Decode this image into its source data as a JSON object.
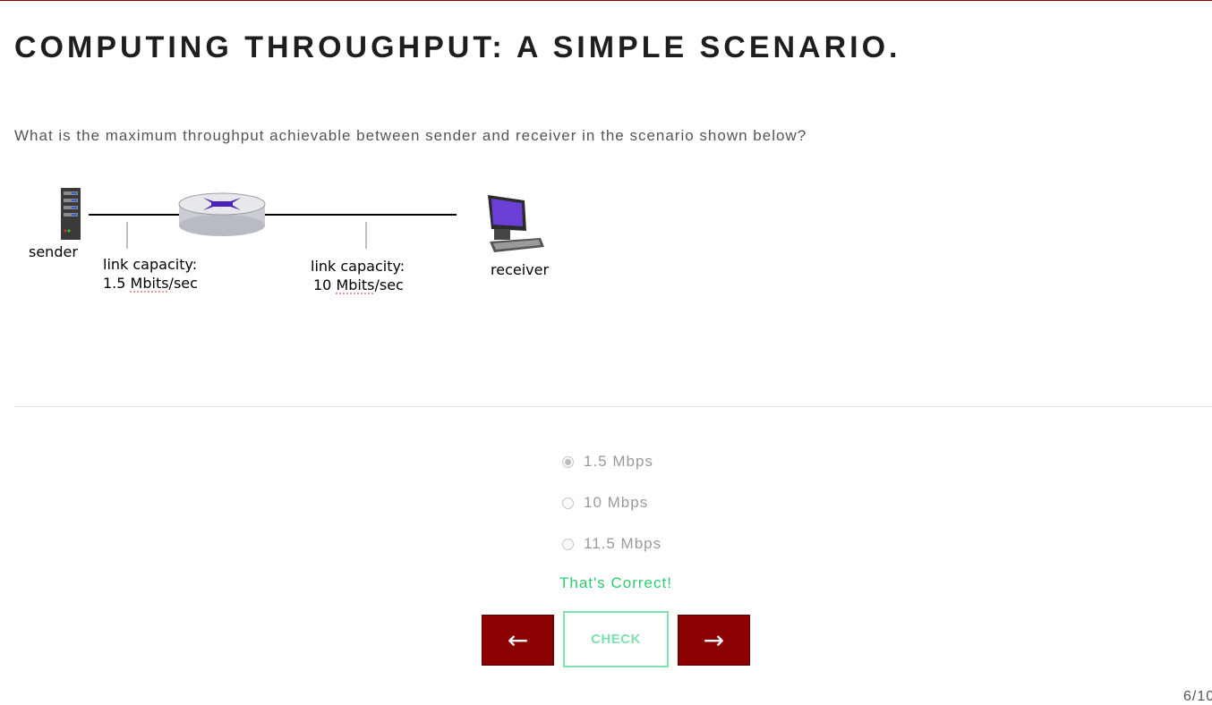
{
  "slide": {
    "title": "COMPUTING THROUGHPUT: A SIMPLE SCENARIO.",
    "question": "What is the maximum throughput achievable between sender and receiver in the scenario shown below?"
  },
  "diagram": {
    "sender_label": "sender",
    "receiver_label": "receiver",
    "link1": {
      "line1": "link capacity:",
      "line2": "1.5 Mbits/sec"
    },
    "link2": {
      "line1": "link capacity:",
      "line2": "10 Mbits/sec"
    }
  },
  "quiz": {
    "options": [
      {
        "label": "1.5 Mbps",
        "selected": true
      },
      {
        "label": "10 Mbps",
        "selected": false
      },
      {
        "label": "11.5 Mbps",
        "selected": false
      }
    ],
    "feedback": "That's Correct!",
    "check_label": "CHECK"
  },
  "nav": {
    "prev_label": "←",
    "next_label": "→",
    "page_counter": "6/10"
  },
  "colors": {
    "accent": "#8b0000",
    "correct": "#2ecc71",
    "check_border": "#7fe0b0"
  }
}
